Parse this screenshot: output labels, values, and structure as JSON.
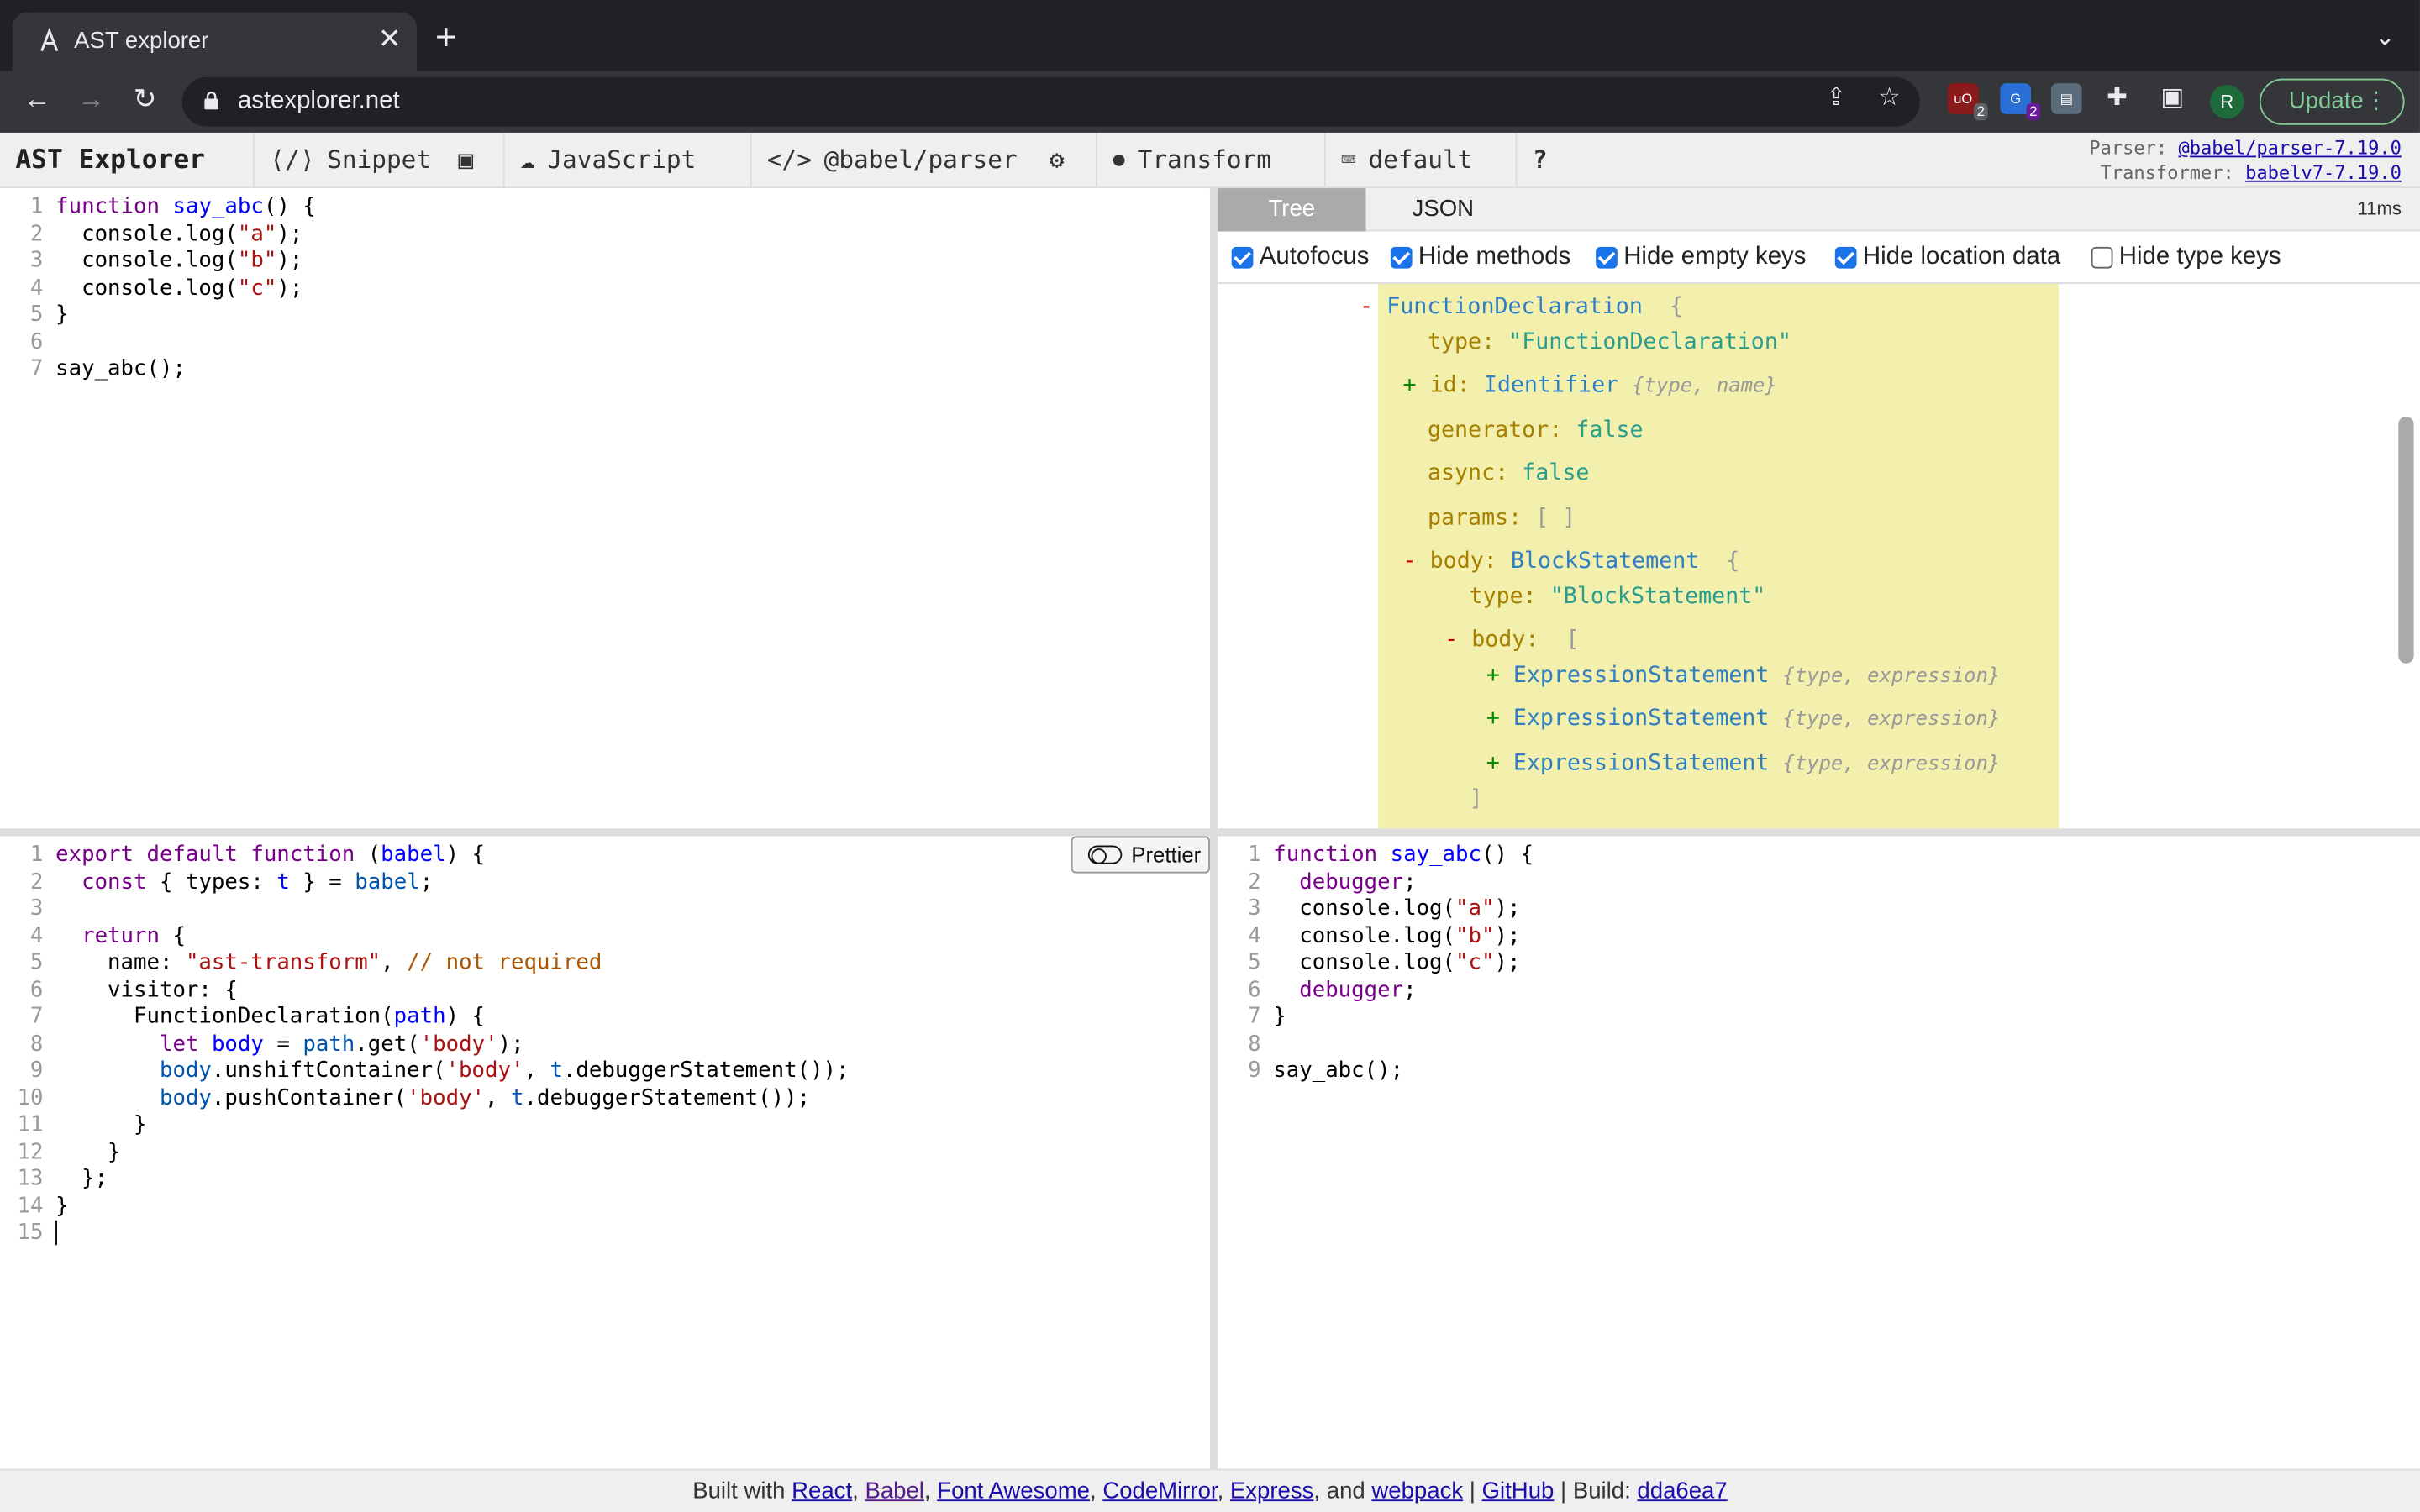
{
  "browser": {
    "tab_title": "AST explorer",
    "url": "astexplorer.net",
    "ext_badges": [
      "2",
      "2"
    ],
    "avatar_initial": "R",
    "update_label": "Update"
  },
  "header": {
    "brand": "AST Explorer",
    "snippet": "Snippet",
    "language": "JavaScript",
    "parser": "@babel/parser",
    "transform": "Transform",
    "keymap": "default",
    "help": "?",
    "parser_label": "Parser:",
    "parser_version": "@babel/parser-7.19.0",
    "transformer_label": "Transformer:",
    "transformer_version": "babelv7-7.19.0"
  },
  "source_code": [
    {
      "n": "1",
      "t": "function say_abc() {"
    },
    {
      "n": "2",
      "t": "  console.log(\"a\");"
    },
    {
      "n": "3",
      "t": "  console.log(\"b\");"
    },
    {
      "n": "4",
      "t": "  console.log(\"c\");"
    },
    {
      "n": "5",
      "t": "}"
    },
    {
      "n": "6",
      "t": ""
    },
    {
      "n": "7",
      "t": "say_abc();"
    }
  ],
  "ast": {
    "tab_tree": "Tree",
    "tab_json": "JSON",
    "timing": "11ms",
    "options": [
      {
        "label": "Autofocus",
        "checked": true
      },
      {
        "label": "Hide methods",
        "checked": true
      },
      {
        "label": "Hide empty keys",
        "checked": true
      },
      {
        "label": "Hide location data",
        "checked": true
      },
      {
        "label": "Hide type keys",
        "checked": false
      }
    ],
    "nodes": {
      "root_type": "FunctionDeclaration",
      "type_key": "type:",
      "type_value": "\"FunctionDeclaration\"",
      "id_key": "id:",
      "id_type": "Identifier",
      "id_meta": "{type, name}",
      "generator_key": "generator:",
      "generator_val": "false",
      "async_key": "async:",
      "async_val": "false",
      "params_key": "params:",
      "params_val": "[ ]",
      "body_key": "body:",
      "body_type": "BlockStatement",
      "body_type_key": "type:",
      "body_type_val": "\"BlockStatement\"",
      "inner_body_key": "body:",
      "expr": "ExpressionStatement",
      "expr_meta": "{type, expression}"
    }
  },
  "transform_code": [
    {
      "n": "1",
      "t": "export default function (babel) {"
    },
    {
      "n": "2",
      "t": "  const { types: t } = babel;"
    },
    {
      "n": "3",
      "t": ""
    },
    {
      "n": "4",
      "t": "  return {"
    },
    {
      "n": "5",
      "t": "    name: \"ast-transform\", // not required"
    },
    {
      "n": "6",
      "t": "    visitor: {"
    },
    {
      "n": "7",
      "t": "      FunctionDeclaration(path) {"
    },
    {
      "n": "8",
      "t": "        let body = path.get('body');"
    },
    {
      "n": "9",
      "t": "        body.unshiftContainer('body', t.debuggerStatement());"
    },
    {
      "n": "10",
      "t": "        body.pushContainer('body', t.debuggerStatement());"
    },
    {
      "n": "11",
      "t": "      }"
    },
    {
      "n": "12",
      "t": "    }"
    },
    {
      "n": "13",
      "t": "  };"
    },
    {
      "n": "14",
      "t": "}"
    },
    {
      "n": "15",
      "t": ""
    }
  ],
  "prettier_label": "Prettier",
  "output_code": [
    {
      "n": "1",
      "t": "function say_abc() {"
    },
    {
      "n": "2",
      "t": "  debugger;"
    },
    {
      "n": "3",
      "t": "  console.log(\"a\");"
    },
    {
      "n": "4",
      "t": "  console.log(\"b\");"
    },
    {
      "n": "5",
      "t": "  console.log(\"c\");"
    },
    {
      "n": "6",
      "t": "  debugger;"
    },
    {
      "n": "7",
      "t": "}"
    },
    {
      "n": "8",
      "t": ""
    },
    {
      "n": "9",
      "t": "say_abc();"
    }
  ],
  "footer": {
    "prefix": "Built with",
    "links": [
      "React",
      "Babel",
      "Font Awesome",
      "CodeMirror",
      "Express",
      "webpack"
    ],
    "and": "and",
    "github": "GitHub",
    "build_label": "Build:",
    "build_hash": "dda6ea7"
  }
}
